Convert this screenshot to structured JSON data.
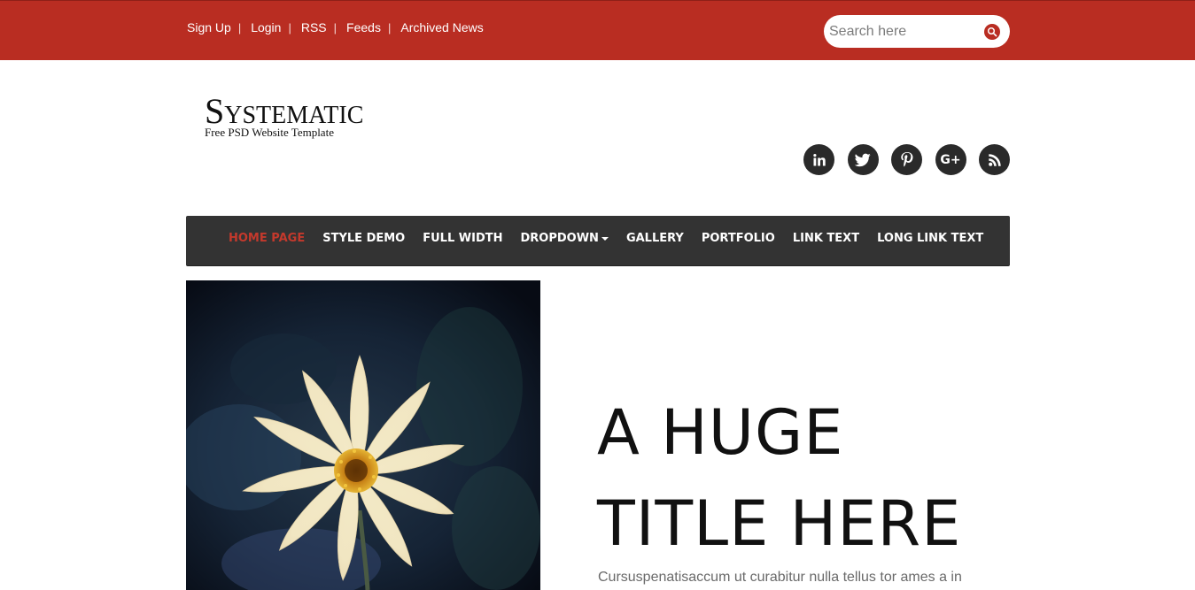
{
  "topbar": {
    "links": [
      "Sign Up",
      "Login",
      "RSS",
      "Feeds",
      "Archived News"
    ],
    "separator": "|",
    "search_placeholder": "Search here"
  },
  "logo": {
    "title": "Systematic",
    "subtitle": "Free PSD Website Template"
  },
  "social": {
    "icons": [
      "linkedin-icon",
      "twitter-icon",
      "pinterest-icon",
      "google-plus-icon",
      "rss-icon"
    ],
    "labels": [
      "in",
      "",
      "",
      "G+",
      ""
    ]
  },
  "nav": {
    "items": [
      "HOME PAGE",
      "STYLE DEMO",
      "FULL WIDTH",
      "DROPDOWN",
      "GALLERY",
      "PORTFOLIO",
      "LINK TEXT",
      "LONG LINK TEXT"
    ],
    "active_index": 0
  },
  "hero": {
    "title_line1": "A HUGE",
    "title_line2": "TITLE HERE",
    "text": "Cursuspenatisaccum ut curabitur nulla tellus tor ames a in"
  },
  "colors": {
    "brand": "#b92d22",
    "nav_bg": "#333333",
    "active_nav": "#c4392c"
  }
}
